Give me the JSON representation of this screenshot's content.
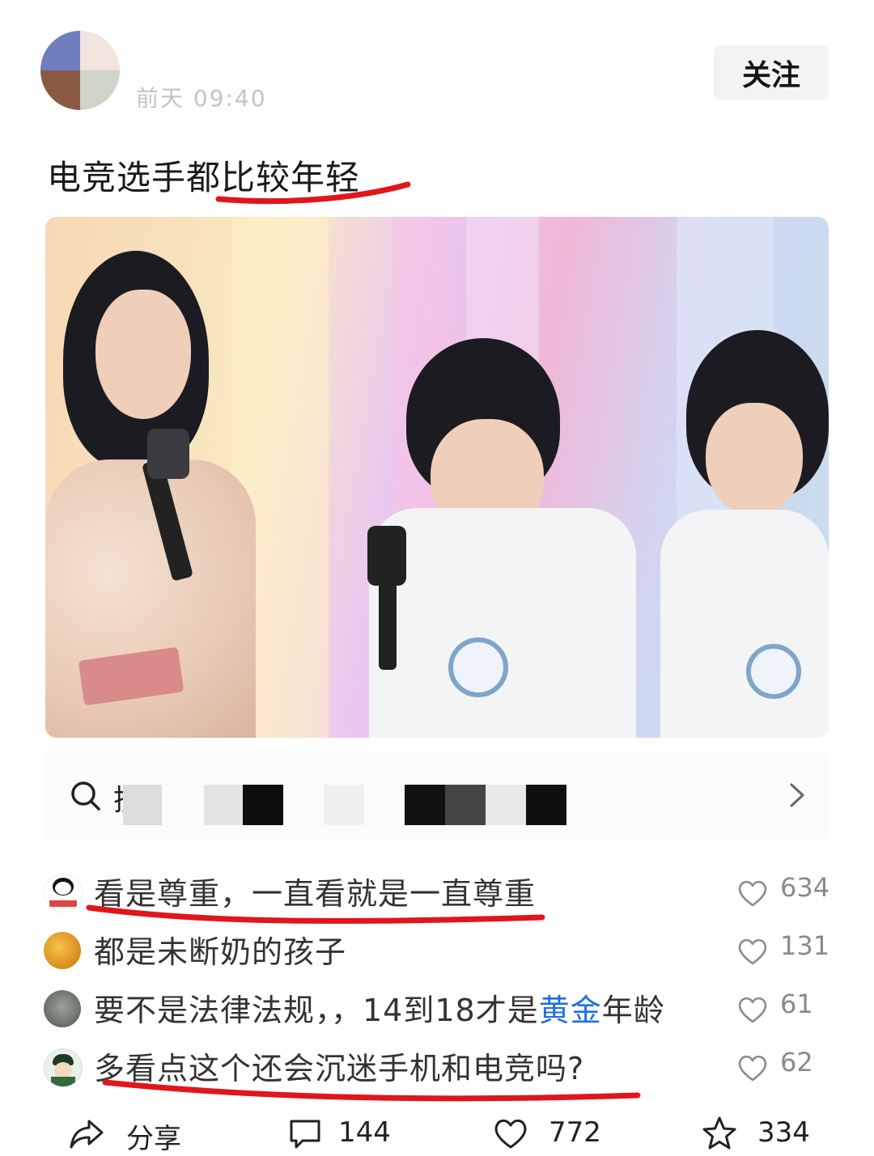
{
  "header": {
    "meta_text": "前天 09:40",
    "follow_label": "关注"
  },
  "post": {
    "text": "电竞选手都比较年轻"
  },
  "search_bar": {
    "text": "搜"
  },
  "comments": [
    {
      "text": "看是尊重，一直看就是一直尊重",
      "likes": "634",
      "icon": "heart-outline"
    },
    {
      "text": "都是未断奶的孩子",
      "likes": "131",
      "icon": "heart-outline"
    },
    {
      "text_before": "要不是法律法规，，14到18才是",
      "text_highlight": "黄金",
      "text_after": "年龄",
      "likes": "61",
      "icon": "heart-outline"
    },
    {
      "text": "多看点这个还会沉迷手机和电竞吗?",
      "likes": "62",
      "icon": "heart-outline"
    }
  ],
  "footer": {
    "share_label": "分享",
    "comment_count": "144",
    "like_count": "772",
    "favorite_count": "334"
  },
  "colors": {
    "annotation_red": "#e0161a",
    "link_blue": "#1f6fe0"
  }
}
